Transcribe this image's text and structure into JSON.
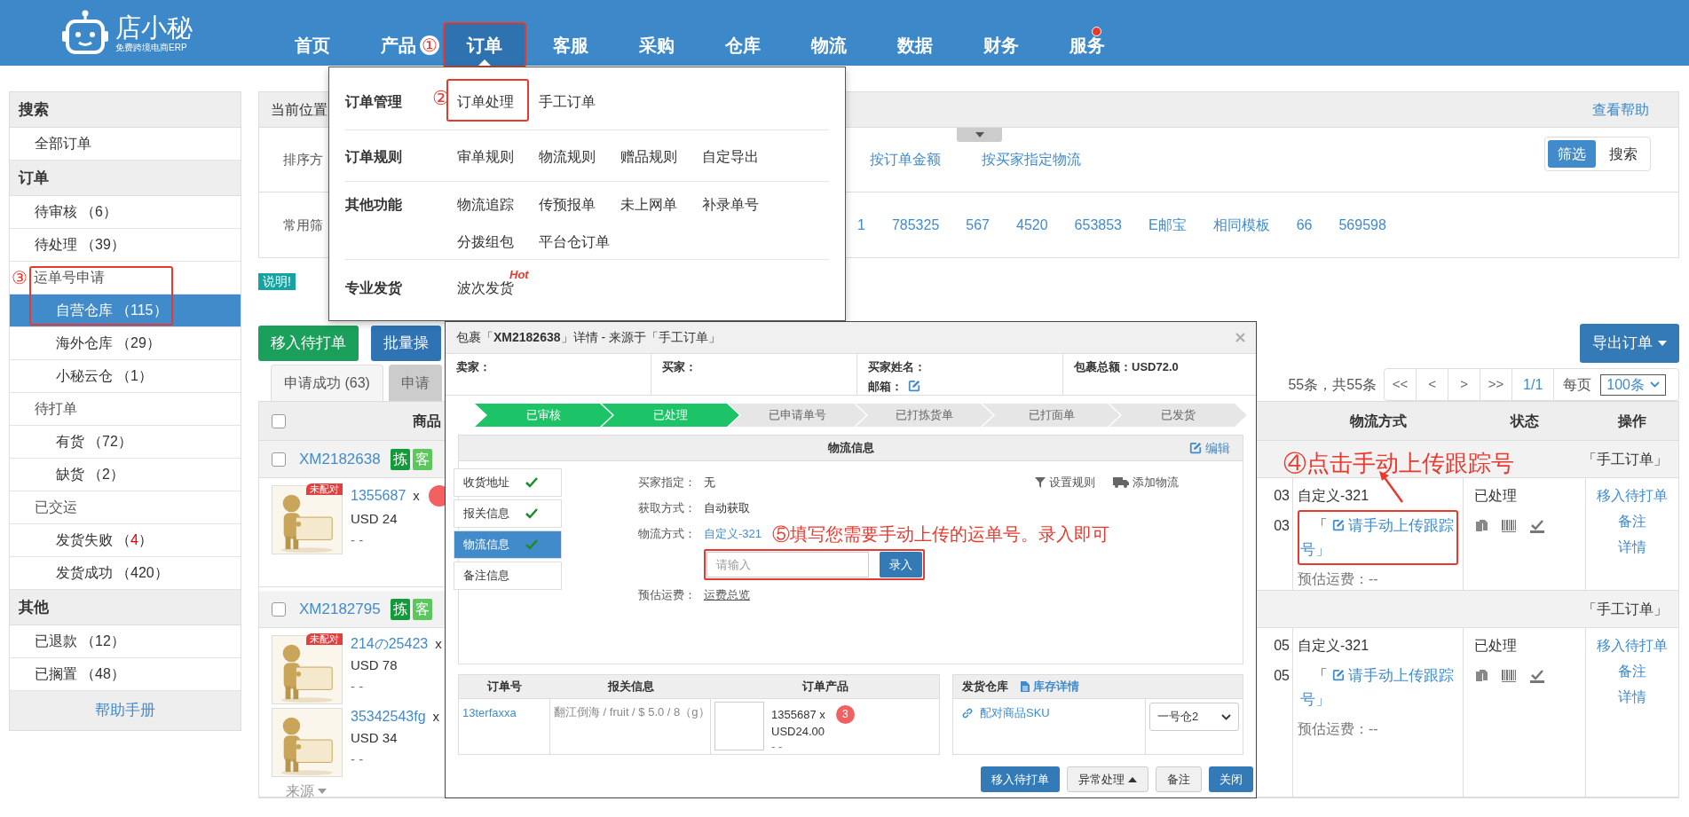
{
  "header": {
    "logo": {
      "name": "店小秘",
      "tagline": "免费跨境电商ERP"
    },
    "nav": [
      {
        "label": "首页",
        "selected": false,
        "annotated": false,
        "dot": false
      },
      {
        "label": "产品",
        "selected": false,
        "annotated": false,
        "dot": false
      },
      {
        "label": "订单",
        "selected": true,
        "annotated": true,
        "dot": false,
        "callout": "①"
      },
      {
        "label": "客服",
        "selected": false,
        "annotated": false,
        "dot": false
      },
      {
        "label": "采购",
        "selected": false,
        "annotated": false,
        "dot": false
      },
      {
        "label": "仓库",
        "selected": false,
        "annotated": false,
        "dot": false
      },
      {
        "label": "物流",
        "selected": false,
        "annotated": false,
        "dot": false
      },
      {
        "label": "数据",
        "selected": false,
        "annotated": false,
        "dot": false
      },
      {
        "label": "财务",
        "selected": false,
        "annotated": false,
        "dot": false
      },
      {
        "label": "服务",
        "selected": false,
        "annotated": false,
        "dot": true
      }
    ]
  },
  "menu": {
    "groups": [
      {
        "title": "订单管理",
        "callout": "②",
        "items": [
          {
            "label": "订单处理",
            "annotated": true
          },
          {
            "label": "手工订单",
            "annotated": false
          }
        ]
      },
      {
        "title": "订单规则",
        "items": [
          {
            "label": "审单规则",
            "annotated": false
          },
          {
            "label": "物流规则",
            "annotated": false
          },
          {
            "label": "赠品规则",
            "annotated": false
          },
          {
            "label": "自定导出",
            "annotated": false
          }
        ]
      },
      {
        "title": "其他功能",
        "items": [
          {
            "label": "物流追踪",
            "annotated": false
          },
          {
            "label": "传预报单",
            "annotated": false
          },
          {
            "label": "未上网单",
            "annotated": false
          },
          {
            "label": "补录单号",
            "annotated": false
          },
          {
            "label": "分拨组包",
            "annotated": false
          },
          {
            "label": "平台仓订单",
            "annotated": false
          }
        ]
      },
      {
        "title": "专业发货",
        "items": [
          {
            "label": "波次发货",
            "annotated": false,
            "tag": "Hot"
          }
        ]
      }
    ]
  },
  "sidebar": {
    "sections": [
      {
        "title": "搜索",
        "items": [
          {
            "label": "全部订单",
            "selected": false
          }
        ]
      },
      {
        "title": "订单",
        "items": [
          {
            "label": "待审核",
            "count": "（6）",
            "selected": false,
            "annotated": false
          },
          {
            "label": "待处理",
            "count": "（39）",
            "selected": false,
            "annotated": false
          },
          {
            "label": "运单号申请",
            "callout": "③",
            "annotated": true,
            "selected": false,
            "children": [
              {
                "label": "自营仓库",
                "count": "（115）",
                "selected": true
              },
              {
                "label": "海外仓库",
                "count": "（29）",
                "selected": false
              },
              {
                "label": "小秘云仓",
                "count": "（1）",
                "selected": false
              }
            ]
          },
          {
            "label": "待打单",
            "selected": false,
            "annotated": false,
            "children": [
              {
                "label": "有货",
                "count": "（72）",
                "selected": false
              },
              {
                "label": "缺货",
                "count": "（2）",
                "selected": false
              }
            ]
          },
          {
            "label": "已交运",
            "selected": false,
            "annotated": false,
            "children": [
              {
                "label": "发货失败",
                "count": "（4）",
                "alert": true,
                "selected": false
              },
              {
                "label": "发货成功",
                "count": "（420）",
                "alert": false,
                "selected": false
              }
            ]
          }
        ]
      },
      {
        "title": "其他",
        "items": [
          {
            "label": "已退款",
            "count": "（12）",
            "selected": false
          },
          {
            "label": "已搁置",
            "count": "（48）",
            "selected": false
          }
        ]
      }
    ],
    "footer": "帮助手册"
  },
  "main": {
    "breadcrumb": "当前位置",
    "help": "查看帮助",
    "filters": {
      "rows": [
        {
          "label": "排序方",
          "links": [
            "按订单金额",
            "按买家指定物流"
          ]
        },
        {
          "label": "常用筛",
          "links": [
            "1",
            "785325",
            "567",
            "4520",
            "653853",
            "E邮宝",
            "相同模板",
            "66",
            "569598"
          ]
        }
      ],
      "modes": [
        {
          "label": "筛选",
          "selected": true
        },
        {
          "label": "搜索",
          "selected": false
        }
      ]
    },
    "notice": "说明!",
    "actions": [
      {
        "label": "移入待打单",
        "kind": "success"
      },
      {
        "label": "批量操",
        "kind": "primary"
      }
    ],
    "export": "导出订单",
    "tabs": [
      {
        "label": "申请成功 (63)",
        "selected": true
      },
      {
        "label": "申请",
        "selected": false
      }
    ],
    "pager": {
      "summary": "55条，共55条",
      "buttons": [
        "<<",
        "<",
        ">",
        ">>"
      ],
      "page": "1/1",
      "per_page_label": "每页",
      "per_page": "100条"
    },
    "table": {
      "columns": [
        "商品",
        "物流方式",
        "状态",
        "操作"
      ],
      "checked": false,
      "annotation": "④点击手动上传跟踪号",
      "orders": [
        {
          "id": "XM2182638",
          "checked": false,
          "tags": [
            {
              "label": "拣",
              "color": "#139a3a"
            },
            {
              "label": "客",
              "color": "#5cc75c"
            }
          ],
          "source": "「手工订单」",
          "products": [
            {
              "sku": "1355687",
              "qty": "x",
              "price": "USD 24",
              "note": "- -",
              "unmatched": "未配对",
              "badge": true
            }
          ],
          "times": [
            "03",
            "03"
          ],
          "method": "自定义-321",
          "upload": {
            "open": "「",
            "label": "请手动上传跟踪号」",
            "annotated": true
          },
          "fee": "预估运费：--",
          "status": "已处理",
          "ops": [
            "移入待打单",
            "备注",
            "详情"
          ]
        },
        {
          "id": "XM2182795",
          "checked": false,
          "tags": [
            {
              "label": "拣",
              "color": "#139a3a"
            },
            {
              "label": "客",
              "color": "#5cc75c"
            }
          ],
          "source": "「手工订单」",
          "products": [
            {
              "sku": "214の25423",
              "qty": "x",
              "price": "USD 78",
              "note": "- -",
              "unmatched": "未配对",
              "badge": false
            },
            {
              "sku": "35342543fg",
              "qty": "x",
              "price": "USD 34",
              "note": "- -",
              "badge": false
            }
          ],
          "more": "来源",
          "times": [
            "05",
            "05"
          ],
          "method": "自定义-321",
          "upload": {
            "open": "「",
            "label": "请手动上传跟踪号」",
            "annotated": false
          },
          "fee": "预估运费：--",
          "status": "已处理",
          "ops": [
            "移入待打单",
            "备注",
            "详情"
          ]
        }
      ]
    }
  },
  "dialog": {
    "title": "包裹「**XM2182638**」详情 - 来源于「手工订单」",
    "info": [
      {
        "label": "卖家："
      },
      {
        "label": "买家："
      },
      {
        "label": "买家姓名：",
        "sub": "邮箱："
      },
      {
        "label": "包裹总额：USD72.0"
      }
    ],
    "steps": [
      {
        "label": "已审核",
        "done": true
      },
      {
        "label": "已处理",
        "done": true
      },
      {
        "label": "已申请单号",
        "done": false
      },
      {
        "label": "已打拣货单",
        "done": false
      },
      {
        "label": "已打面单",
        "done": false
      },
      {
        "label": "已发货",
        "done": false
      }
    ],
    "panel": {
      "title": "物流信息",
      "edit": "编辑",
      "tabs": [
        {
          "label": "收货地址",
          "done": true,
          "selected": false
        },
        {
          "label": "报关信息",
          "done": true,
          "selected": false
        },
        {
          "label": "物流信息",
          "done": true,
          "selected": true
        },
        {
          "label": "备注信息",
          "done": false,
          "selected": false
        }
      ],
      "fields": [
        {
          "kind": "text",
          "label": "买家指定：",
          "value": "无"
        },
        {
          "kind": "text",
          "label": "获取方式：",
          "value": "自动获取"
        },
        {
          "kind": "link",
          "label": "物流方式：",
          "value": "自定义-321",
          "annotation": "⑤填写您需要手动上传的运单号。录入即可"
        },
        {
          "kind": "input",
          "placeholder": "请输入",
          "button": "录入",
          "annotated": true
        },
        {
          "kind": "underline",
          "label": "预估运费：",
          "value": "运费总览"
        }
      ],
      "tools": [
        {
          "label": "设置规则",
          "kind": "filter"
        },
        {
          "label": "添加物流",
          "kind": "truck"
        }
      ]
    },
    "order_table": {
      "columns": [
        "订单号",
        "报关信息",
        "订单产品"
      ],
      "rows": [
        {
          "order_no": "13terfaxxa",
          "customs": "翻江倒海 / fruit / $ 5.0 / 8（g）",
          "sku": "1355687 x",
          "qty": "3",
          "price": "USD24.00",
          "note": "- -"
        }
      ]
    },
    "warehouse": {
      "title": "发货仓库",
      "stock_link": "库存详情",
      "pair_link": "配对商品SKU",
      "select": "一号仓2"
    },
    "buttons": [
      {
        "label": "移入待打单",
        "kind": "primary"
      },
      {
        "label": "异常处理",
        "kind": "dropdown"
      },
      {
        "label": "备注",
        "kind": "default"
      },
      {
        "label": "关闭",
        "kind": "primary"
      }
    ]
  }
}
